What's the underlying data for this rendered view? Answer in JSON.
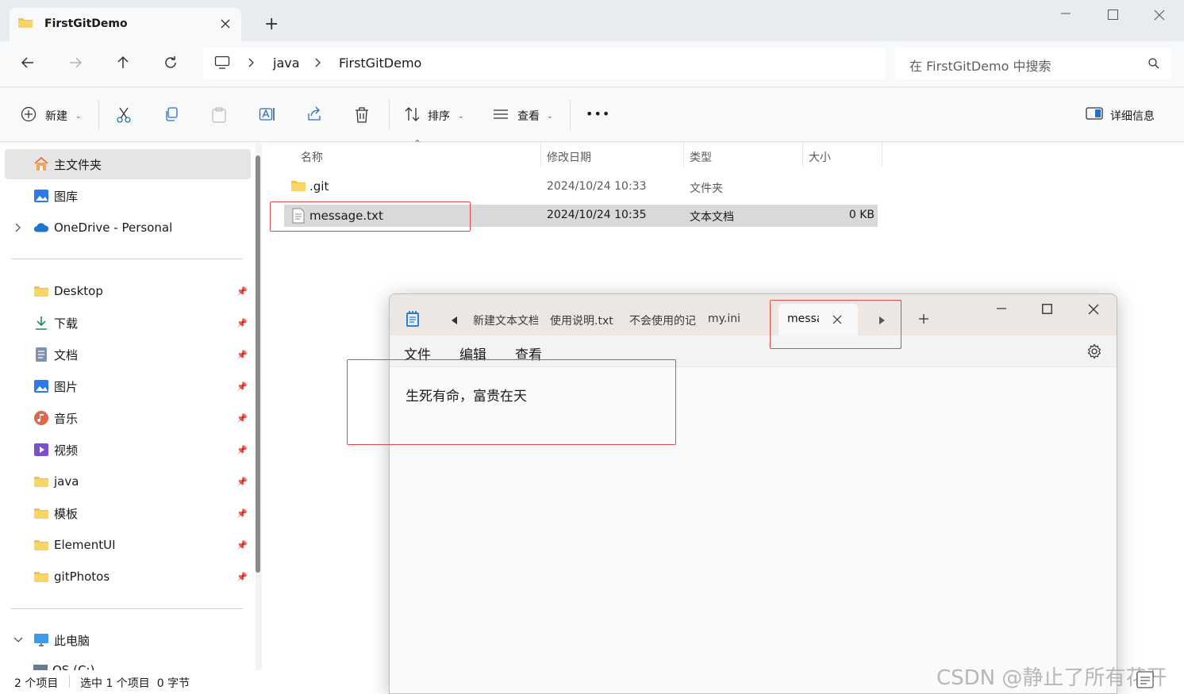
{
  "window": {
    "tab_title": "FirstGitDemo",
    "new_tab_glyph": "+"
  },
  "address": {
    "segments": [
      "java",
      "FirstGitDemo"
    ],
    "search_placeholder": "在 FirstGitDemo 中搜索"
  },
  "toolbar": {
    "new_label": "新建",
    "sort_label": "排序",
    "view_label": "查看",
    "more_label": "•••",
    "details_label": "详细信息"
  },
  "sidebar": {
    "top_items": [
      {
        "label": "主文件夹",
        "icon": "home-icon"
      },
      {
        "label": "图库",
        "icon": "gallery-icon"
      },
      {
        "label": "OneDrive - Personal",
        "icon": "cloud-icon"
      }
    ],
    "pinned_items": [
      {
        "label": "Desktop",
        "icon": "folder-icon"
      },
      {
        "label": "下载",
        "icon": "download-icon"
      },
      {
        "label": "文档",
        "icon": "document-icon"
      },
      {
        "label": "图片",
        "icon": "pictures-icon"
      },
      {
        "label": "音乐",
        "icon": "music-icon"
      },
      {
        "label": "视频",
        "icon": "video-icon"
      },
      {
        "label": "java",
        "icon": "folder-icon"
      },
      {
        "label": "模板",
        "icon": "folder-icon"
      },
      {
        "label": "ElementUI",
        "icon": "folder-icon"
      },
      {
        "label": "gitPhotos",
        "icon": "folder-icon"
      }
    ],
    "this_pc": "此电脑",
    "drive_partial": "OS (C:)"
  },
  "columns": {
    "name": "名称",
    "modified": "修改日期",
    "type": "类型",
    "size": "大小"
  },
  "files": [
    {
      "name": ".git",
      "modified": "2024/10/24 10:33",
      "type": "文件夹",
      "size": ""
    },
    {
      "name": "message.txt",
      "modified": "2024/10/24 10:35",
      "type": "文本文档",
      "size": "0 KB"
    }
  ],
  "status": {
    "count": "2 个项目",
    "selection": "选中 1 个项目  0 字节"
  },
  "notepad": {
    "tabs": [
      "新建文本文档",
      "使用说明.txt",
      "不会使用的记",
      "my.ini"
    ],
    "active_tab": "message.txt",
    "menu": [
      "文件",
      "编辑",
      "查看"
    ],
    "content": "生死有命，富贵在天"
  },
  "watermark": "CSDN @静止了所有花开",
  "colors": {
    "highlight_red": "#e14a4a",
    "selected_row": "#d9d9d9",
    "folder_yellow": "#f5c242"
  }
}
